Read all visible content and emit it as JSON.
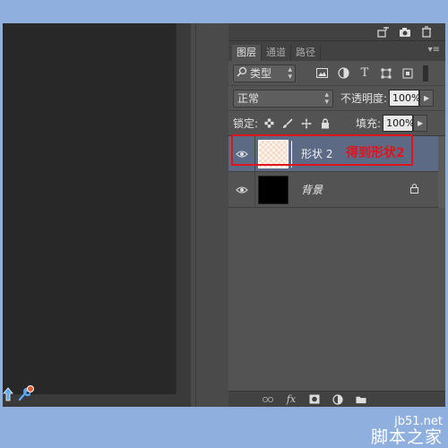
{
  "tabs": [
    {
      "label": "图层",
      "active": true
    },
    {
      "label": "通道",
      "active": false
    },
    {
      "label": "路径",
      "active": false
    }
  ],
  "filter": {
    "label": "类型"
  },
  "filter_icons": [
    "image-filter-icon",
    "adjustment-filter-icon",
    "text-filter-icon",
    "shape-filter-icon",
    "smart-object-filter-icon"
  ],
  "filter_glyphs": {
    "text": "T"
  },
  "blend": {
    "mode": "正常",
    "opacity_label": "不透明度:",
    "opacity_value": "100%"
  },
  "lock": {
    "label": "锁定:",
    "fill_label": "填充:",
    "fill_value": "100%"
  },
  "layers": [
    {
      "name": "形状 2",
      "selected": true
    },
    {
      "name": "背景",
      "selected": false,
      "locked": true
    }
  ],
  "annotation": {
    "text": "得到形状2",
    "color": "#e0141c"
  },
  "bottombar": {
    "fx": "fx"
  },
  "watermark": {
    "url": "jb51.net",
    "name": "脚本之家"
  },
  "colors": {
    "panel": "#535353",
    "selected_layer": "#5d6a86",
    "canvas": "#282828",
    "background": "#8fb0de"
  }
}
